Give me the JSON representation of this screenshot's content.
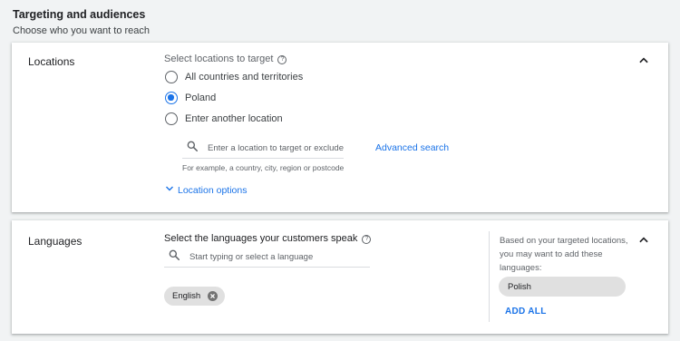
{
  "header": {
    "title": "Targeting and audiences",
    "subtitle": "Choose who you want to reach"
  },
  "locations": {
    "title": "Locations",
    "select_label": "Select locations to target",
    "options": [
      {
        "label": "All countries and territories",
        "checked": false
      },
      {
        "label": "Poland",
        "checked": true
      },
      {
        "label": "Enter another location",
        "checked": false
      }
    ],
    "search": {
      "placeholder": "Enter a location to target or exclude",
      "hint": "For example, a country, city, region or postcode"
    },
    "advanced_search": "Advanced search",
    "location_options": "Location options"
  },
  "languages": {
    "title": "Languages",
    "select_label": "Select the languages your customers speak",
    "search_placeholder": "Start typing or select a language",
    "selected": [
      "English"
    ],
    "suggestion_text": "Based on your targeted locations, you may want to add these languages:",
    "suggested": [
      "Polish"
    ],
    "add_all": "ADD ALL"
  },
  "icons": {
    "search": "search-icon",
    "help": "help-icon",
    "collapse": "chevron-up-icon",
    "expand": "chevron-down-icon",
    "remove": "cancel-icon"
  },
  "colors": {
    "accent": "#1a73e8",
    "page_bg": "#f1f3f4",
    "chip_bg": "#e0e0e0"
  }
}
